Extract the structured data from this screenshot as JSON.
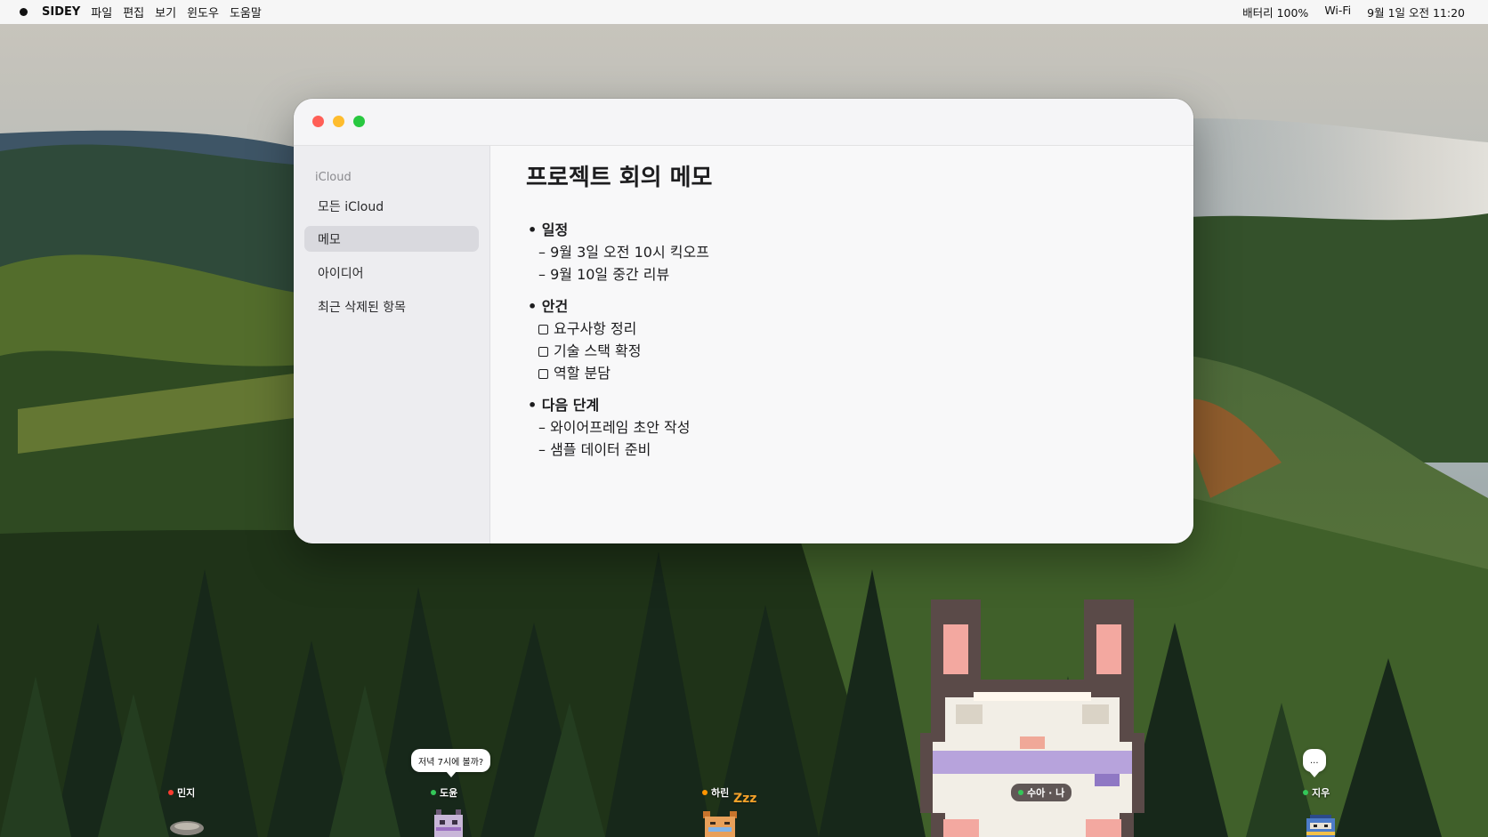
{
  "menubar": {
    "app_name": "SIDEY",
    "menus": [
      "파일",
      "편집",
      "보기",
      "윈도우",
      "도움말"
    ],
    "battery": "배터리 100%",
    "wifi": "Wi-Fi",
    "datetime": "9월 1일 오전 11:20"
  },
  "sidebar": {
    "section_label": "iCloud",
    "items": [
      {
        "label": "모든 iCloud",
        "active": false
      },
      {
        "label": "메모",
        "active": true
      },
      {
        "label": "아이디어",
        "active": false
      },
      {
        "label": "최근 삭제된 항목",
        "active": false
      }
    ]
  },
  "note": {
    "title": "프로젝트 회의 메모",
    "sections": [
      {
        "heading": "• 일정",
        "lines": [
          "– 9월 3일 오전 10시 킥오프",
          "– 9월 10일 중간 리뷰"
        ]
      },
      {
        "heading": "• 안건",
        "checklist": [
          "요구사항 정리",
          "기술 스택 확정",
          "역할 분담"
        ]
      },
      {
        "heading": "• 다음 단계",
        "lines": [
          "– 와이어프레임 초안 작성",
          "– 샘플 데이터 준비"
        ]
      }
    ]
  },
  "characters": [
    {
      "name": "민지",
      "status_color": "#ff3b30"
    },
    {
      "name": "도윤",
      "status_color": "#34c759",
      "bubble": "저녁 7시에 볼까?"
    },
    {
      "name": "하린",
      "status_color": "#ff9500",
      "zzz": "Zzz"
    },
    {
      "name": "수아 · 나",
      "status_color": "#34c759"
    },
    {
      "name": "지우",
      "status_color": "#34c759",
      "bubble": "..."
    }
  ]
}
